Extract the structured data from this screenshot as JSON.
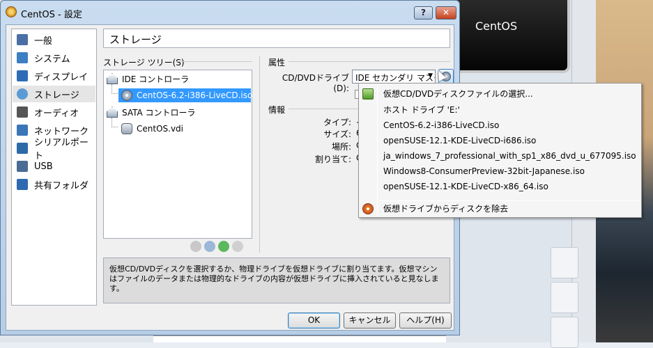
{
  "window": {
    "title": "CentOS - 設定",
    "help_button": "?",
    "close_button": "✕"
  },
  "background": {
    "video_label": "CentOS"
  },
  "sidebar": {
    "items": [
      {
        "label": "一般",
        "icon": "general-icon",
        "color": "#4a6fa5"
      },
      {
        "label": "システム",
        "icon": "system-chip-icon",
        "color": "#3d7fc2"
      },
      {
        "label": "ディスプレイ",
        "icon": "display-monitor-icon",
        "color": "#2e6db5"
      },
      {
        "label": "ストレージ",
        "icon": "storage-disk-icon",
        "color": "#5b9bd5",
        "active": true
      },
      {
        "label": "オーディオ",
        "icon": "audio-speaker-icon",
        "color": "#555555"
      },
      {
        "label": "ネットワーク",
        "icon": "network-icon",
        "color": "#3a75b8"
      },
      {
        "label": "シリアルポート",
        "icon": "serial-port-icon",
        "color": "#2d6aa8"
      },
      {
        "label": "USB",
        "icon": "usb-icon",
        "color": "#4b6c92"
      },
      {
        "label": "共有フォルダ",
        "icon": "shared-folder-icon",
        "color": "#2f69b0"
      }
    ]
  },
  "page_title": "ストレージ",
  "storage_tree": {
    "label": "ストレージ ツリー(S)",
    "items": [
      {
        "label": "IDE コントローラ",
        "icon": "ide-controller-icon",
        "level": 0
      },
      {
        "label": "CentOS-6.2-i386-LiveCD.iso",
        "icon": "optical-disc-icon",
        "level": 1,
        "selected": true
      },
      {
        "label": "SATA コントローラ",
        "icon": "sata-controller-icon",
        "level": 0
      },
      {
        "label": "CentOS.vdi",
        "icon": "hard-disk-icon",
        "level": 1
      }
    ],
    "tools": [
      "add-attachment-icon",
      "add-cd-icon",
      "add-controller-icon",
      "remove-controller-icon"
    ]
  },
  "attributes": {
    "label": "属性",
    "drive_label": "CD/DVDドライブ(D):",
    "drive_value": "IDE セカンダリ マスタ",
    "dropdown_arrow": "▼"
  },
  "info": {
    "label": "情報",
    "rows": [
      {
        "label": "タイプ:",
        "value": "イ"
      },
      {
        "label": "サイズ:",
        "value": "6"
      },
      {
        "label": "場所:",
        "value": "C"
      },
      {
        "label": "割り当て:",
        "value": "C"
      }
    ]
  },
  "description": "仮想CD/DVDディスクを選択するか、物理ドライブを仮想ドライブに割り当てます。仮想マシンはファイルのデータまたは物理的なドライブの内容が仮想ドライブに挿入されていると見なします。",
  "buttons": {
    "ok": "OK",
    "cancel": "キャンセル",
    "help": "ヘルプ(H)"
  },
  "menu": {
    "choose_file": "仮想CD/DVDディスクファイルの選択...",
    "items": [
      "ホスト ドライブ 'E:'",
      "CentOS-6.2-i386-LiveCD.iso",
      "openSUSE-12.1-KDE-LiveCD-i686.iso",
      "ja_windows_7_professional_with_sp1_x86_dvd_u_677095.iso",
      "Windows8-ConsumerPreview-32bit-Japanese.iso",
      "openSUSE-12.1-KDE-LiveCD-x86_64.iso"
    ],
    "remove_disk": "仮想ドライブからディスクを除去"
  }
}
